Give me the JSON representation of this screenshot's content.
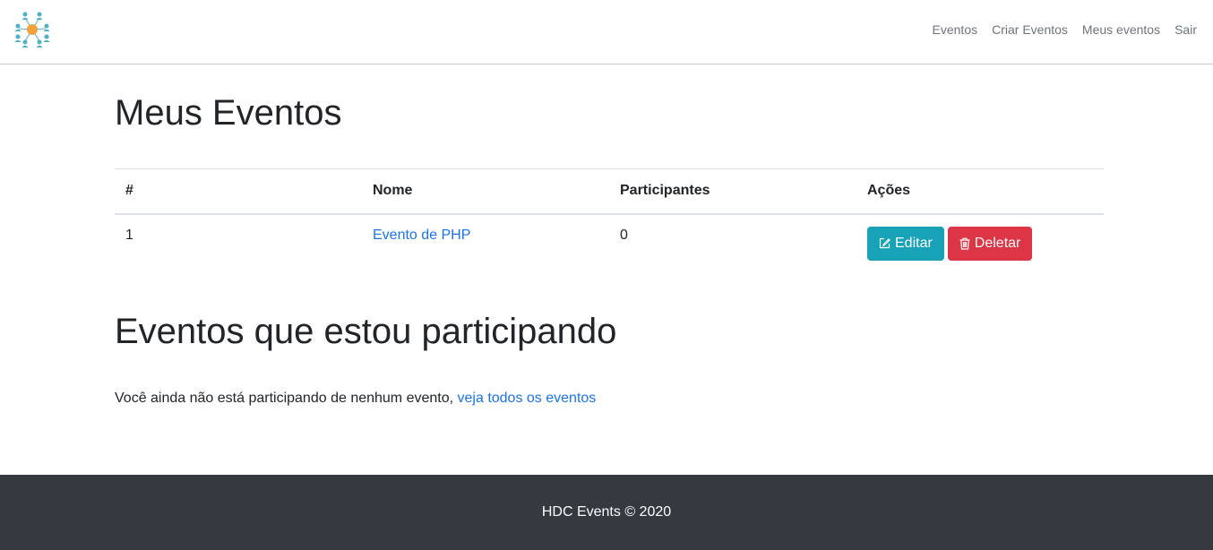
{
  "navbar": {
    "logo_icon": "people-network-icon",
    "links": [
      "Eventos",
      "Criar Eventos",
      "Meus eventos",
      "Sair"
    ]
  },
  "my_events": {
    "title": "Meus Eventos",
    "columns": [
      "#",
      "Nome",
      "Participantes",
      "Ações"
    ],
    "rows": [
      {
        "index": "1",
        "name": "Evento de PHP",
        "participants": "0",
        "edit_label": "Editar",
        "delete_label": "Deletar"
      }
    ]
  },
  "participating": {
    "title": "Eventos que estou participando",
    "message": "Você ainda não está participando de nenhum evento, ",
    "link_text": "veja todos os eventos"
  },
  "footer": {
    "text": "HDC Events © 2020"
  },
  "colors": {
    "edit_button": "#17a2b8",
    "delete_button": "#dc3545",
    "link": "#1a73e8",
    "footer_bg": "#343a40",
    "logo_people": "#4fb0c6",
    "logo_center": "#f2a33a"
  }
}
